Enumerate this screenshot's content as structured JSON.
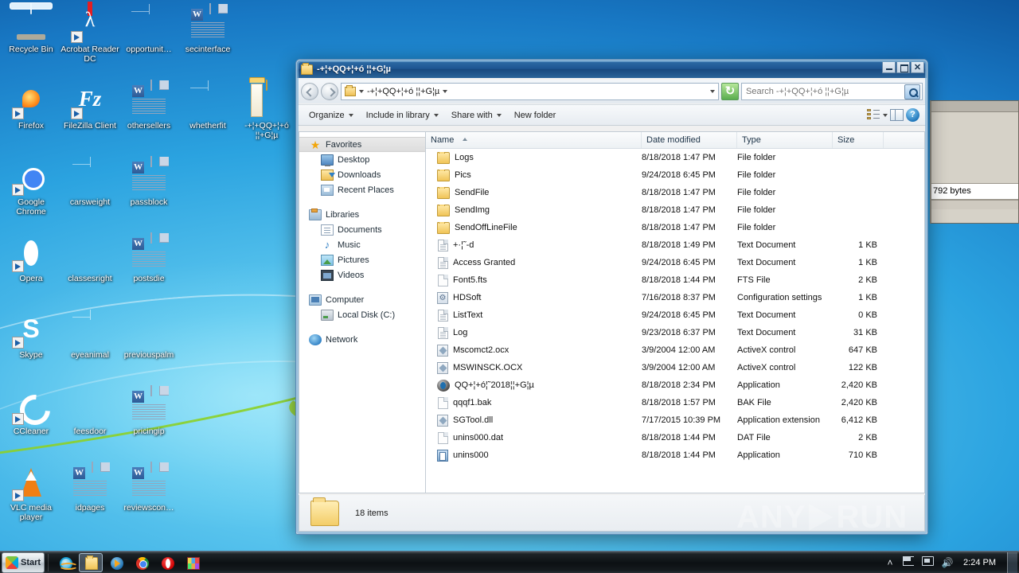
{
  "desktop": {
    "icons": [
      {
        "label": "Recycle Bin",
        "glyph": "recycle-bin",
        "col": 0,
        "row": 0,
        "shortcut": false
      },
      {
        "label": "Acrobat\nReader DC",
        "glyph": "acrobat",
        "col": 1,
        "row": 0,
        "shortcut": true
      },
      {
        "label": "opportunit…",
        "glyph": "blank-doc",
        "col": 2,
        "row": 0,
        "shortcut": false
      },
      {
        "label": "secinterface",
        "glyph": "word-doc",
        "col": 3,
        "row": 0,
        "shortcut": false
      },
      {
        "label": "Firefox",
        "glyph": "firefox",
        "col": 0,
        "row": 1,
        "shortcut": true
      },
      {
        "label": "FileZilla Client",
        "glyph": "filezilla",
        "col": 1,
        "row": 1,
        "shortcut": true
      },
      {
        "label": "othersellers",
        "glyph": "word-doc",
        "col": 2,
        "row": 1,
        "shortcut": false
      },
      {
        "label": "whetherfit",
        "glyph": "blank-doc",
        "col": 3,
        "row": 1,
        "shortcut": false
      },
      {
        "label": "-+¦+QQ+¦+ó ¦¦+G¦µ",
        "glyph": "open-folder",
        "col": 4,
        "row": 1,
        "shortcut": false
      },
      {
        "label": "Google\nChrome",
        "glyph": "chrome",
        "col": 0,
        "row": 2,
        "shortcut": true
      },
      {
        "label": "carsweight",
        "glyph": "blank-doc",
        "col": 1,
        "row": 2,
        "shortcut": false
      },
      {
        "label": "passblock",
        "glyph": "word-doc",
        "col": 2,
        "row": 2,
        "shortcut": false
      },
      {
        "label": "Opera",
        "glyph": "opera",
        "col": 0,
        "row": 3,
        "shortcut": true
      },
      {
        "label": "classesright",
        "glyph": "black-thumb",
        "col": 1,
        "row": 3,
        "shortcut": false
      },
      {
        "label": "postsdie",
        "glyph": "word-doc",
        "col": 2,
        "row": 3,
        "shortcut": false
      },
      {
        "label": "Skype",
        "glyph": "skype",
        "col": 0,
        "row": 4,
        "shortcut": true
      },
      {
        "label": "eyeanimal",
        "glyph": "blank-doc",
        "col": 1,
        "row": 4,
        "shortcut": false
      },
      {
        "label": "previouspalm",
        "glyph": "black-thumb",
        "col": 2,
        "row": 4,
        "shortcut": false
      },
      {
        "label": "CCleaner",
        "glyph": "ccleaner",
        "col": 0,
        "row": 5,
        "shortcut": true
      },
      {
        "label": "feesdoor",
        "glyph": "black-thumb",
        "col": 1,
        "row": 5,
        "shortcut": false
      },
      {
        "label": "pricingip",
        "glyph": "word-doc",
        "col": 2,
        "row": 5,
        "shortcut": false
      },
      {
        "label": "VLC media\nplayer",
        "glyph": "vlc",
        "col": 0,
        "row": 6,
        "shortcut": true
      },
      {
        "label": "idpages",
        "glyph": "word-doc",
        "col": 1,
        "row": 6,
        "shortcut": false
      },
      {
        "label": "reviewscon…",
        "glyph": "word-doc",
        "col": 2,
        "row": 6,
        "shortcut": false
      }
    ]
  },
  "background_window": {
    "status_text": "792 bytes"
  },
  "explorer": {
    "title": "-+¦+QQ+¦+ó ¦¦+G¦µ",
    "window_buttons": {
      "minimize": "–",
      "maximize": "□",
      "close": "✕"
    },
    "address": {
      "path_text": "-+¦+QQ+¦+ó ¦¦+G¦µ",
      "back_tooltip": "Back",
      "forward_tooltip": "Forward"
    },
    "search": {
      "placeholder": "Search -+¦+QQ+¦+ó ¦¦+G¦µ",
      "value": ""
    },
    "toolbar": {
      "organize": "Organize",
      "include_in_library": "Include in library",
      "share_with": "Share with",
      "new_folder": "New folder"
    },
    "nav_pane": {
      "groups": [
        {
          "head": "Favorites",
          "head_icon": "star-icon",
          "selected": true,
          "items": [
            {
              "label": "Desktop",
              "icon": "desktop-icon"
            },
            {
              "label": "Downloads",
              "icon": "downloads-icon"
            },
            {
              "label": "Recent Places",
              "icon": "recent-places-icon"
            }
          ]
        },
        {
          "head": "Libraries",
          "head_icon": "libraries-icon",
          "selected": false,
          "items": [
            {
              "label": "Documents",
              "icon": "documents-icon"
            },
            {
              "label": "Music",
              "icon": "music-icon"
            },
            {
              "label": "Pictures",
              "icon": "pictures-icon"
            },
            {
              "label": "Videos",
              "icon": "videos-icon"
            }
          ]
        },
        {
          "head": "Computer",
          "head_icon": "computer-icon",
          "selected": false,
          "items": [
            {
              "label": "Local Disk (C:)",
              "icon": "disk-icon"
            }
          ]
        },
        {
          "head": "Network",
          "head_icon": "network-icon",
          "selected": false,
          "items": []
        }
      ]
    },
    "columns": [
      {
        "key": "name",
        "label": "Name",
        "sorted": "asc"
      },
      {
        "key": "date",
        "label": "Date modified",
        "sorted": ""
      },
      {
        "key": "type",
        "label": "Type",
        "sorted": ""
      },
      {
        "key": "size",
        "label": "Size",
        "sorted": ""
      }
    ],
    "files": [
      {
        "name": "Logs",
        "date": "8/18/2018 1:47 PM",
        "type": "File folder",
        "size": "",
        "icon": "folder"
      },
      {
        "name": "Pics",
        "date": "9/24/2018 6:45 PM",
        "type": "File folder",
        "size": "",
        "icon": "folder"
      },
      {
        "name": "SendFile",
        "date": "8/18/2018 1:47 PM",
        "type": "File folder",
        "size": "",
        "icon": "folder"
      },
      {
        "name": "SendImg",
        "date": "8/18/2018 1:47 PM",
        "type": "File folder",
        "size": "",
        "icon": "folder"
      },
      {
        "name": "SendOffLineFile",
        "date": "8/18/2018 1:47 PM",
        "type": "File folder",
        "size": "",
        "icon": "folder"
      },
      {
        "name": "+·¦˜-d",
        "date": "8/18/2018 1:49 PM",
        "type": "Text Document",
        "size": "1 KB",
        "icon": "text"
      },
      {
        "name": "Access Granted",
        "date": "9/24/2018 6:45 PM",
        "type": "Text Document",
        "size": "1 KB",
        "icon": "text"
      },
      {
        "name": "Font5.fts",
        "date": "8/18/2018 1:44 PM",
        "type": "FTS File",
        "size": "2 KB",
        "icon": "blank"
      },
      {
        "name": "HDSoft",
        "date": "7/16/2018 8:37 PM",
        "type": "Configuration settings",
        "size": "1 KB",
        "icon": "config"
      },
      {
        "name": "ListText",
        "date": "9/24/2018 6:45 PM",
        "type": "Text Document",
        "size": "0 KB",
        "icon": "text"
      },
      {
        "name": "Log",
        "date": "9/23/2018 6:37 PM",
        "type": "Text Document",
        "size": "31 KB",
        "icon": "text"
      },
      {
        "name": "Mscomct2.ocx",
        "date": "3/9/2004 12:00 AM",
        "type": "ActiveX control",
        "size": "647 KB",
        "icon": "ocx"
      },
      {
        "name": "MSWINSCK.OCX",
        "date": "3/9/2004 12:00 AM",
        "type": "ActiveX control",
        "size": "122 KB",
        "icon": "ocx"
      },
      {
        "name": "QQ+¦+ó¦˜2018¦¦+G¦µ",
        "date": "8/18/2018 2:34 PM",
        "type": "Application",
        "size": "2,420 KB",
        "icon": "app"
      },
      {
        "name": "qqqf1.bak",
        "date": "8/18/2018 1:57 PM",
        "type": "BAK File",
        "size": "2,420 KB",
        "icon": "blank"
      },
      {
        "name": "SGTool.dll",
        "date": "7/17/2015 10:39 PM",
        "type": "Application extension",
        "size": "6,412 KB",
        "icon": "ocx"
      },
      {
        "name": "unins000.dat",
        "date": "8/18/2018 1:44 PM",
        "type": "DAT File",
        "size": "2 KB",
        "icon": "blank"
      },
      {
        "name": "unins000",
        "date": "8/18/2018 1:44 PM",
        "type": "Application",
        "size": "710 KB",
        "icon": "setup"
      }
    ],
    "status": {
      "item_count": "18 items"
    }
  },
  "watermark": {
    "left": "ANY",
    "right": "RUN"
  },
  "taskbar": {
    "start_label": "Start",
    "apps": [
      {
        "name": "internet-explorer",
        "glyph": "g-ie",
        "active": false
      },
      {
        "name": "windows-explorer",
        "glyph": "g-exp",
        "active": true
      },
      {
        "name": "media-player",
        "glyph": "g-wmp",
        "active": false
      },
      {
        "name": "google-chrome",
        "glyph": "g-chrome",
        "active": false
      },
      {
        "name": "opera",
        "glyph": "g-opera",
        "active": false
      },
      {
        "name": "tiles-app",
        "glyph": "g-tiles",
        "active": false
      }
    ],
    "tray": {
      "chevron": "˄",
      "action_center": "flag-icon",
      "network": "network-icon",
      "volume": "🔊",
      "clock": "2:24 PM"
    }
  }
}
